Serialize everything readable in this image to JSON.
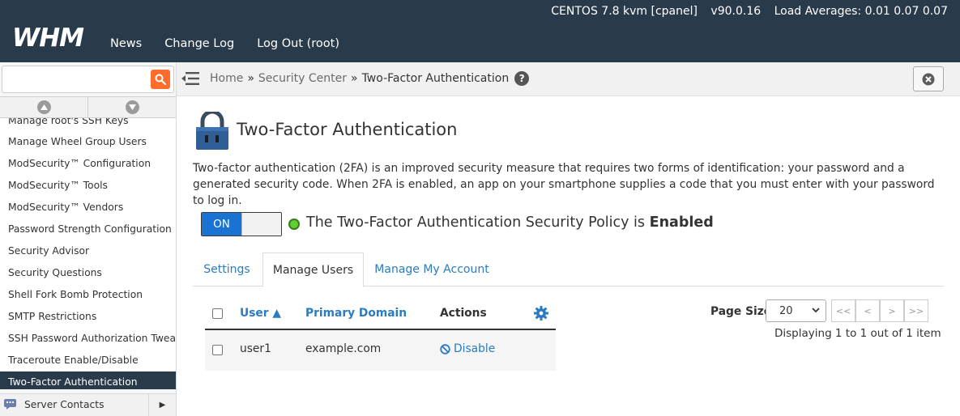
{
  "header": {
    "logo_text": "WHM",
    "system_info": {
      "os": "CENTOS 7.8 kvm [cpanel]",
      "version": "v90.0.16",
      "load": "Load Averages: 0.01 0.07 0.07"
    },
    "nav": [
      {
        "label": "News"
      },
      {
        "label": "Change Log"
      },
      {
        "label": "Log Out (root)"
      }
    ]
  },
  "sidebar": {
    "search": {
      "value": "",
      "placeholder": ""
    },
    "items": [
      {
        "label": "Manage root's SSH Keys"
      },
      {
        "label": "Manage Wheel Group Users"
      },
      {
        "label": "ModSecurity™ Configuration"
      },
      {
        "label": "ModSecurity™ Tools"
      },
      {
        "label": "ModSecurity™ Vendors"
      },
      {
        "label": "Password Strength Configuration"
      },
      {
        "label": "Security Advisor"
      },
      {
        "label": "Security Questions"
      },
      {
        "label": "Shell Fork Bomb Protection"
      },
      {
        "label": "SMTP Restrictions"
      },
      {
        "label": "SSH Password Authorization Tweak"
      },
      {
        "label": "Traceroute Enable/Disable"
      },
      {
        "label": "Two-Factor Authentication"
      }
    ],
    "bottom_section": {
      "label": "Server Contacts"
    }
  },
  "breadcrumb": {
    "items": [
      "Home",
      "Security Center",
      "Two-Factor Authentication"
    ],
    "separator": "»",
    "help_glyph": "?"
  },
  "page": {
    "title": "Two-Factor Authentication",
    "description": "Two-factor authentication (2FA) is an improved security measure that requires two forms of identification: your password and a generated security code. When 2FA is enabled, an app on your smartphone supplies a code that you must enter with your password to log in.",
    "toggle": {
      "state_label": "ON"
    },
    "policy": {
      "prefix": "The Two-Factor Authentication Security Policy is",
      "status": "Enabled"
    },
    "tabs": [
      {
        "label": "Settings",
        "active": false
      },
      {
        "label": "Manage Users",
        "active": true
      },
      {
        "label": "Manage My Account",
        "active": false
      }
    ]
  },
  "table": {
    "columns": [
      {
        "label": "User ▲"
      },
      {
        "label": "Primary Domain"
      },
      {
        "label": "Actions"
      }
    ],
    "rows": [
      {
        "user": "user1",
        "domain": "example.com",
        "action": "Disable"
      }
    ]
  },
  "pager": {
    "label": "Page Size",
    "page_size": "20",
    "buttons": [
      "<<",
      "<",
      ">",
      ">>"
    ],
    "display": "Displaying 1 to 1 out of 1 item"
  },
  "colors": {
    "header_bg": "#293a4a",
    "accent_orange": "#ff6c2c",
    "link_blue": "#2a7bc0",
    "toggle_blue": "#1a73d4",
    "status_green": "#5fd12e"
  }
}
